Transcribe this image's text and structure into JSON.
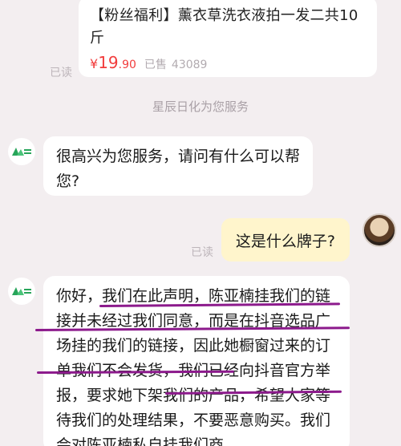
{
  "product_card": {
    "title": "【粉丝福利】薰衣草洗衣液拍一发二共10斤",
    "price_currency": "¥",
    "price_main": "19",
    "price_decimal": ".90",
    "sold_label": "已售",
    "sold_count": "43089"
  },
  "status": {
    "read_label": "已读"
  },
  "system_note": "星辰日化为您服务",
  "messages": [
    {
      "side": "left",
      "text": "很高兴为您服务，请问有什么可以帮您?"
    },
    {
      "side": "right",
      "text": "这是什么牌子?"
    },
    {
      "side": "left",
      "text": "你好，我们在此声明，陈亚楠挂我们的链接并未经过我们同意，而是在抖音选品广场挂的我们的链接，因此她橱窗过来的订单我们不会发货，我们已经向抖音官方举报，要求她下架我们的产品，希望大家等待我们的处理结果，不要恶意购买。我们会对陈亚楠私自挂我们商"
    }
  ],
  "colors": {
    "price": "#f23c3c",
    "user_bubble": "#fff5cc",
    "bot_logo": "#27a55a",
    "underline": "#8c1a8c"
  },
  "icons": {
    "bot_avatar": "brand-logo-icon",
    "user_avatar": "user-avatar-icon"
  }
}
